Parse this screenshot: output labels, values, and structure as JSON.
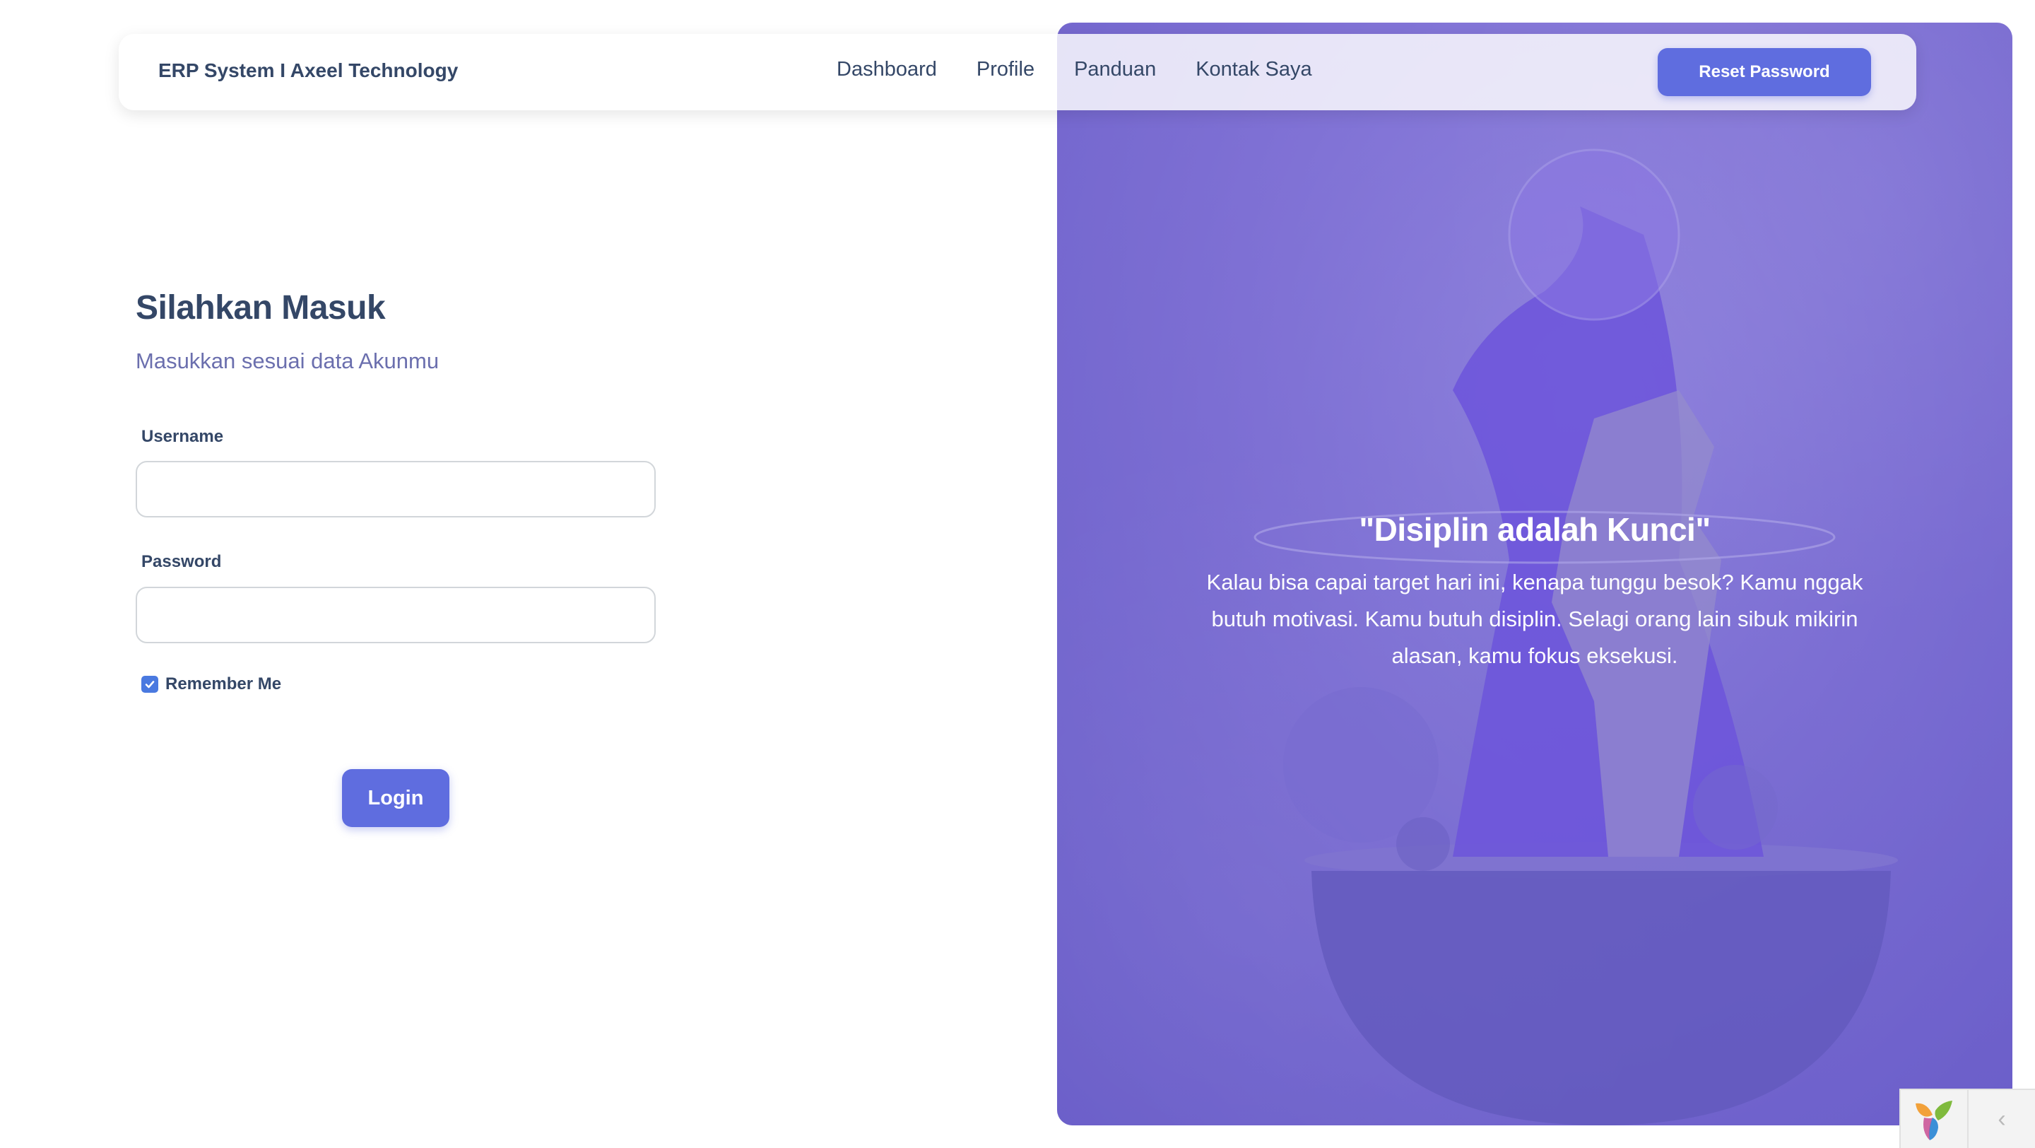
{
  "navbar": {
    "brand": "ERP System I Axeel Technology",
    "links": [
      "Dashboard",
      "Profile",
      "Panduan",
      "Kontak Saya"
    ],
    "reset_label": "Reset Password"
  },
  "login": {
    "title": "Silahkan Masuk",
    "subtitle": "Masukkan sesuai data Akunmu",
    "username_label": "Username",
    "username_value": "",
    "password_label": "Password",
    "password_value": "",
    "remember_label": "Remember Me",
    "remember_checked": true,
    "login_label": "Login"
  },
  "hero": {
    "quote_title": "\"Disiplin adalah Kunci\"",
    "quote_text": "Kalau bisa capai target hari ini, kenapa tunggu besok? Kamu nggak butuh motivasi. Kamu butuh disiplin. Selagi orang lain sibuk mikirin alasan, kamu fokus eksekusi."
  },
  "debug_toolbar": {
    "toggle_icon": "chevron-left-icon",
    "logo_icon": "yii-logo-icon"
  },
  "colors": {
    "accent": "#5f6ddf",
    "hero_purple": "#8d7fd9",
    "text_dark": "#344767",
    "subtitle": "#6b6fae"
  }
}
